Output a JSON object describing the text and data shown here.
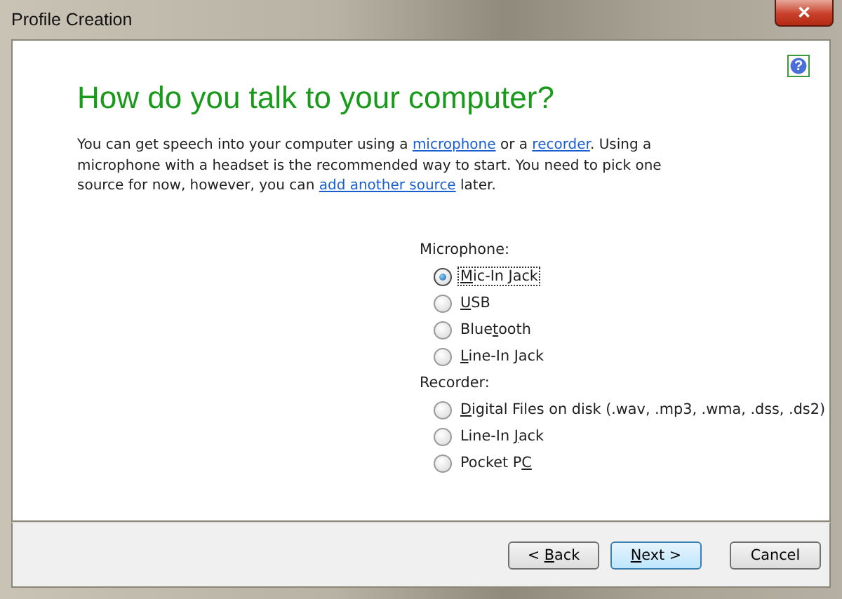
{
  "window": {
    "title": "Profile Creation",
    "close": "✕"
  },
  "help": "?",
  "heading": "How do you talk to your computer?",
  "intro": [
    {
      "kind": "text",
      "text": "You can get speech into your computer using a "
    },
    {
      "kind": "link",
      "text": "microphone"
    },
    {
      "kind": "text",
      "text": " or a "
    },
    {
      "kind": "link",
      "text": "recorder"
    },
    {
      "kind": "text",
      "text": ". Using a microphone with a headset is the recommended way to start. You need to pick one source for now, however, you can "
    },
    {
      "kind": "link",
      "text": "add another source"
    },
    {
      "kind": "text",
      "text": " later."
    }
  ],
  "groups": [
    {
      "label": "Microphone:",
      "options": [
        {
          "key": "M",
          "after": "ic-In Jack",
          "selected": true
        },
        {
          "key": "U",
          "after": "SB",
          "selected": false
        },
        {
          "before": "Blue",
          "key": "t",
          "after": "ooth",
          "selected": false
        },
        {
          "key": "L",
          "after": "ine-In Jack",
          "selected": false
        }
      ]
    },
    {
      "label": "Recorder:",
      "options": [
        {
          "key": "D",
          "after": "igital Files on disk (.wav, .mp3, .wma, .dss, .ds2)",
          "selected": false
        },
        {
          "before": "Line-In ",
          "key": "J",
          "after": "ack",
          "selected": false
        },
        {
          "before": "Pocket P",
          "key": "C",
          "selected": false
        }
      ]
    }
  ],
  "buttons": [
    {
      "before": "< ",
      "key": "B",
      "after": "ack",
      "default": false
    },
    {
      "key": "N",
      "after": "ext >",
      "default": true
    },
    {
      "before": "Cancel",
      "default": false
    }
  ]
}
